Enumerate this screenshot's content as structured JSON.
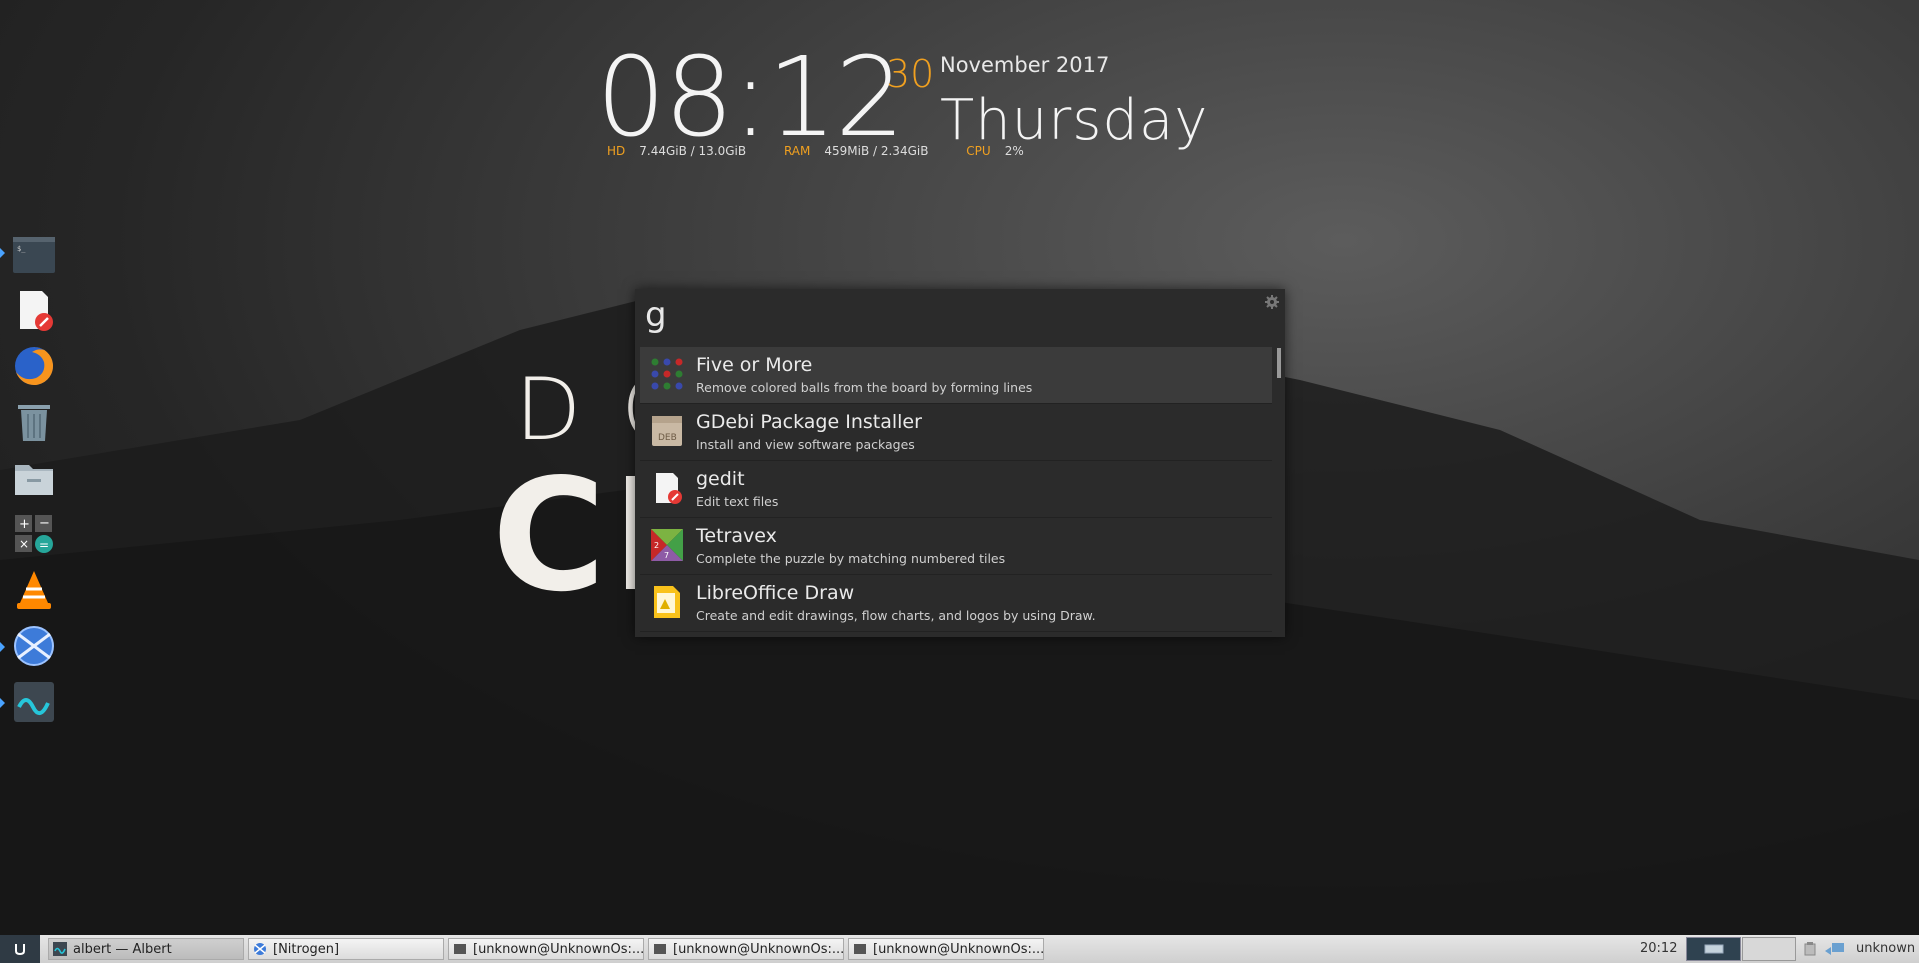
{
  "desktop": {
    "quote_line1": "DO IT TO",
    "quote_line2": "CH GE"
  },
  "conky": {
    "time": "08:12",
    "day_number": "30",
    "month_year": "November 2017",
    "weekday": "Thursday",
    "hd_label": "HD",
    "hd_value": "7.44GiB / 13.0GiB",
    "ram_label": "RAM",
    "ram_value": "459MiB / 2.34GiB",
    "cpu_label": "CPU",
    "cpu_value": "2%"
  },
  "dock": {
    "items": [
      "terminal-icon",
      "gedit-icon",
      "firefox-icon",
      "trash-icon",
      "file-manager-icon",
      "calculator-icon",
      "vlc-icon",
      "network-icon",
      "albert-icon"
    ]
  },
  "launcher": {
    "query": "g",
    "results": [
      {
        "title": "Five or More",
        "subtitle": "Remove colored balls from the board by forming lines",
        "icon": "five-or-more-icon"
      },
      {
        "title": "GDebi Package Installer",
        "subtitle": "Install and view software packages",
        "icon": "gdebi-icon"
      },
      {
        "title": "gedit",
        "subtitle": "Edit text files",
        "icon": "gedit-icon"
      },
      {
        "title": "Tetravex",
        "subtitle": "Complete the puzzle by matching numbered tiles",
        "icon": "tetravex-icon"
      },
      {
        "title": "LibreOffice Draw",
        "subtitle": "Create and edit drawings, flow charts, and logos by using Draw.",
        "icon": "libreoffice-draw-icon"
      }
    ],
    "deb_label": "DEB"
  },
  "taskbar": {
    "tasks": [
      {
        "label": "albert — Albert"
      },
      {
        "label": "[Nitrogen]"
      },
      {
        "label": "[unknown@UnknownOs:..."
      },
      {
        "label": "[unknown@UnknownOs:..."
      },
      {
        "label": "[unknown@UnknownOs:..."
      }
    ],
    "clock": "20:12",
    "user": "unknown"
  },
  "colors": {
    "accent": "#f0a020",
    "launcher_bg": "#2b2b2b"
  }
}
